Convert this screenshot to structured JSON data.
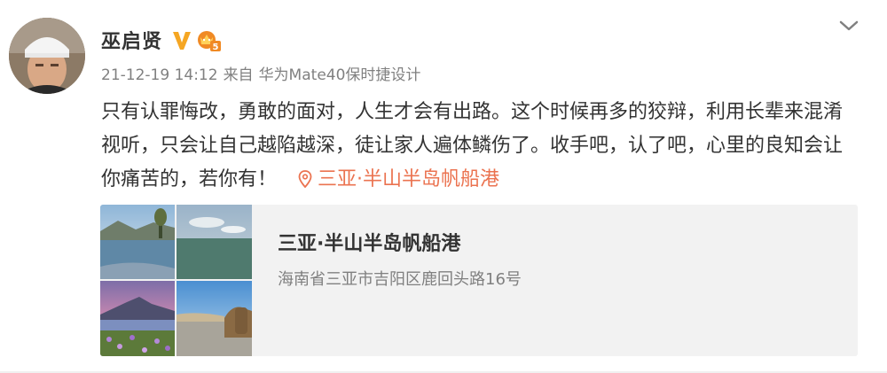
{
  "post": {
    "author": "巫启贤",
    "timestamp": "21-12-19 14:12",
    "source_prefix": "来自",
    "source_device": "华为Mate40保时捷设计",
    "text": "只有认罪悔改，勇敢的面对，人生才会有出路。这个时候再多的狡辩，利用长辈来混淆视听，只会让自己越陷越深，徒让家人遍体鳞伤了。收手吧，认了吧，心里的良知会让你痛苦的，若你有！",
    "location_link": "三亚·半山半岛帆船港",
    "member_level": "5"
  },
  "location_card": {
    "title": "三亚·半山半岛帆船港",
    "address": "海南省三亚市吉阳区鹿回头路16号"
  },
  "colors": {
    "accent": "#eb7350",
    "vip_gold": "#f5a623",
    "card_bg": "#f2f2f2",
    "muted_text": "#808080"
  },
  "icons": {
    "verified": "verified-v-icon",
    "member": "member-crown-icon",
    "expand": "chevron-down-icon",
    "location": "location-pin-icon"
  }
}
